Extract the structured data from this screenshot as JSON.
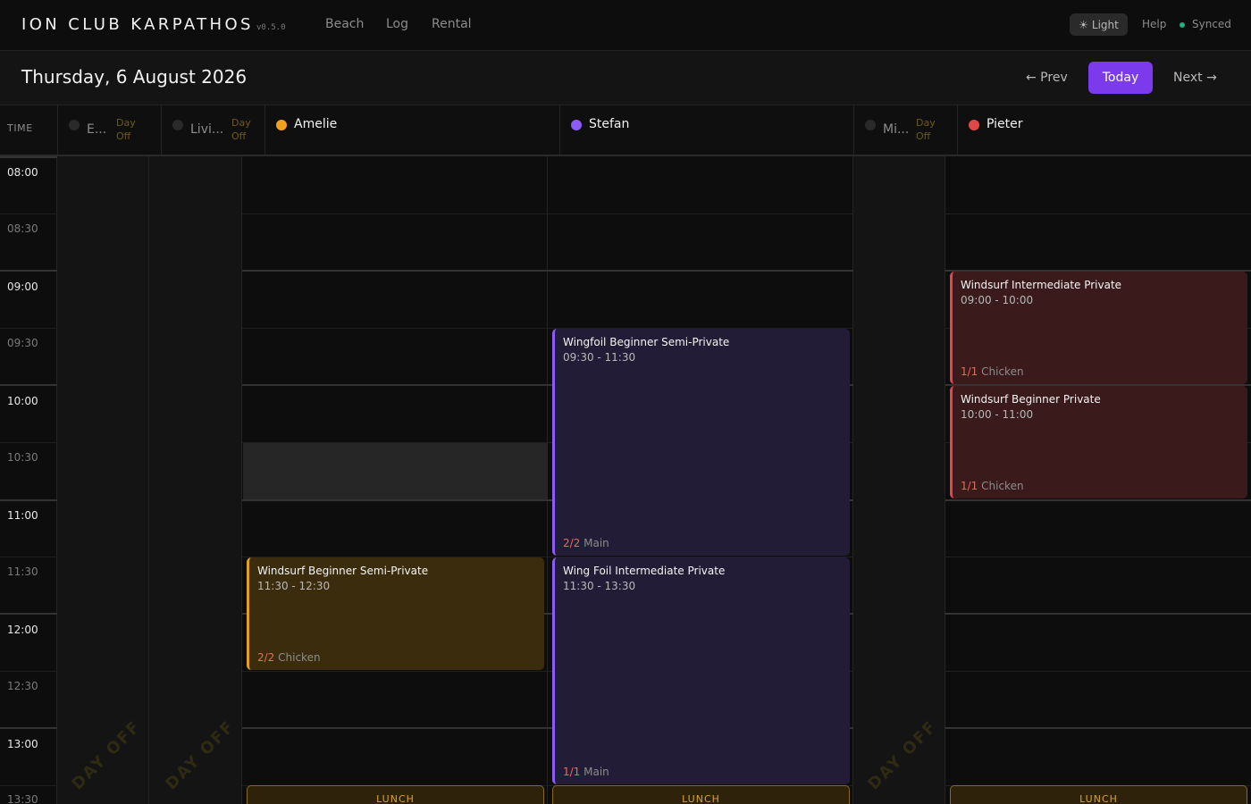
{
  "app": {
    "brand": "ION CLUB KARPATHOS",
    "version": "v0.5.0",
    "nav": [
      "Beach",
      "Log",
      "Rental"
    ],
    "theme_label": "Light",
    "help_label": "Help",
    "sync_status": "Synced"
  },
  "datebar": {
    "date": "Thursday, 6 August 2026",
    "prev_label": "← Prev",
    "today_label": "Today",
    "next_label": "Next →"
  },
  "header": {
    "time_label": "TIME",
    "day_off_top": "Day",
    "day_off_bottom": "Off",
    "instructors": [
      {
        "name": "E...",
        "color": "#2a2a2a",
        "day_off": true
      },
      {
        "name": "Livi...",
        "color": "#2a2a2a",
        "day_off": true
      },
      {
        "name": "Amelie",
        "color": "#f0a11e",
        "day_off": false
      },
      {
        "name": "Stefan",
        "color": "#8b5cf6",
        "day_off": false
      },
      {
        "name": "Mi...",
        "color": "#2a2a2a",
        "day_off": true
      },
      {
        "name": "Pieter",
        "color": "#e04848",
        "day_off": false
      }
    ]
  },
  "grid": {
    "time_slots": [
      "08:00",
      "08:30",
      "09:00",
      "09:30",
      "10:00",
      "10:30",
      "11:00",
      "11:30",
      "12:00",
      "12:30",
      "13:00",
      "13:30"
    ],
    "day_off_watermark": "DAY OFF",
    "lunch_label": "LUNCH"
  },
  "events": {
    "amelie_1": {
      "title": "Windsurf Beginner Semi-Private",
      "time": "11:30 - 12:30",
      "count": "2/2",
      "location": "Chicken"
    },
    "stefan_1": {
      "title": "Wingfoil Beginner Semi-Private",
      "time": "09:30 - 11:30",
      "count": "2/2",
      "location": "Main"
    },
    "stefan_2": {
      "title": "Wing Foil Intermediate Private",
      "time": "11:30 - 13:30",
      "count": "1/1",
      "location": "Main"
    },
    "pieter_1": {
      "title": "Windsurf Intermediate Private",
      "time": "09:00 - 10:00",
      "count": "1/1",
      "location": "Chicken"
    },
    "pieter_2": {
      "title": "Windsurf Beginner Private",
      "time": "10:00 - 11:00",
      "count": "1/1",
      "location": "Chicken"
    }
  },
  "colors": {
    "accent": "#7c3aed",
    "synced": "#22b07d"
  }
}
